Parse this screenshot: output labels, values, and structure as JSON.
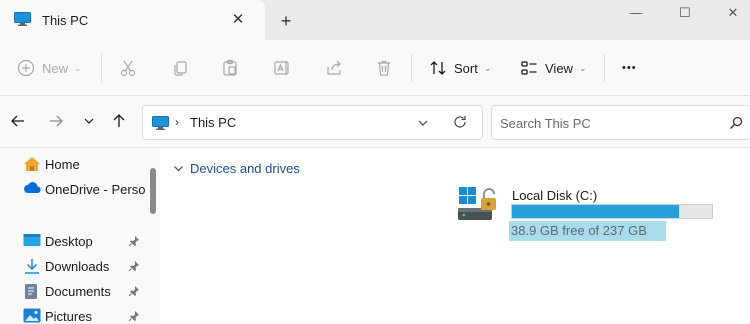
{
  "window": {
    "tab_title": "This PC",
    "tab_icon": "monitor-icon",
    "close_tab_icon": "close-icon",
    "new_tab_icon": "plus-icon",
    "minimize_glyph": "—",
    "maximize_glyph": "☐",
    "close_glyph": "✕"
  },
  "toolbar": {
    "new_label": "New",
    "sort_label": "Sort",
    "view_label": "View",
    "more_glyph": "•••",
    "disabled_icons": [
      "cut-icon",
      "copy-icon",
      "paste-icon",
      "rename-icon",
      "share-icon",
      "delete-icon"
    ]
  },
  "address": {
    "location_icon": "monitor-icon",
    "separator": "›",
    "path": "This PC",
    "search_placeholder": "Search This PC"
  },
  "nav": {
    "items": [
      {
        "label": "Home",
        "icon": "home-icon",
        "pinned": false
      },
      {
        "label": "OneDrive - Personal",
        "icon": "onedrive-icon",
        "pinned": false
      },
      {
        "label": "Desktop",
        "icon": "desktop-folder-icon",
        "pinned": true
      },
      {
        "label": "Downloads",
        "icon": "download-icon",
        "pinned": true
      },
      {
        "label": "Documents",
        "icon": "documents-icon",
        "pinned": true
      },
      {
        "label": "Pictures",
        "icon": "pictures-icon",
        "pinned": true
      }
    ]
  },
  "content": {
    "group_label": "Devices and drives",
    "drives": [
      {
        "name": "Local Disk (C:)",
        "free_text": "38.9 GB free of 237 GB",
        "used_fraction": 0.836,
        "icon": "drive-windows-lock-icon"
      }
    ]
  },
  "colors": {
    "accent": "#26a0da",
    "group_header": "#1f4c8e",
    "selection": "#a9dceb"
  }
}
